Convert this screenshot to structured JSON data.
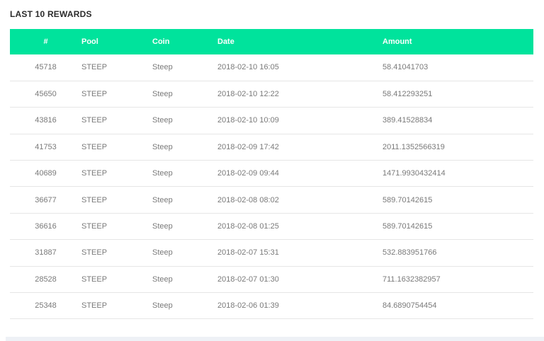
{
  "section": {
    "title": "LAST 10 REWARDS"
  },
  "table": {
    "headers": {
      "num": "#",
      "pool": "Pool",
      "coin": "Coin",
      "date": "Date",
      "amount": "Amount"
    },
    "rows": [
      {
        "num": "45718",
        "pool": "STEEP",
        "coin": "Steep",
        "date": "2018-02-10 16:05",
        "amount": "58.41041703"
      },
      {
        "num": "45650",
        "pool": "STEEP",
        "coin": "Steep",
        "date": "2018-02-10 12:22",
        "amount": "58.412293251"
      },
      {
        "num": "43816",
        "pool": "STEEP",
        "coin": "Steep",
        "date": "2018-02-10 10:09",
        "amount": "389.41528834"
      },
      {
        "num": "41753",
        "pool": "STEEP",
        "coin": "Steep",
        "date": "2018-02-09 17:42",
        "amount": "2011.1352566319"
      },
      {
        "num": "40689",
        "pool": "STEEP",
        "coin": "Steep",
        "date": "2018-02-09 09:44",
        "amount": "1471.9930432414"
      },
      {
        "num": "36677",
        "pool": "STEEP",
        "coin": "Steep",
        "date": "2018-02-08 08:02",
        "amount": "589.70142615"
      },
      {
        "num": "36616",
        "pool": "STEEP",
        "coin": "Steep",
        "date": "2018-02-08 01:25",
        "amount": "589.70142615"
      },
      {
        "num": "31887",
        "pool": "STEEP",
        "coin": "Steep",
        "date": "2018-02-07 15:31",
        "amount": "532.883951766"
      },
      {
        "num": "28528",
        "pool": "STEEP",
        "coin": "Steep",
        "date": "2018-02-07 01:30",
        "amount": "711.1632382957"
      },
      {
        "num": "25348",
        "pool": "STEEP",
        "coin": "Steep",
        "date": "2018-02-06 01:39",
        "amount": "84.6890754454"
      }
    ]
  },
  "colors": {
    "header_bg": "#00e39c",
    "header_text": "#ffffff",
    "cell_text": "#7a7a7a",
    "row_divider": "#e6e6e6"
  }
}
